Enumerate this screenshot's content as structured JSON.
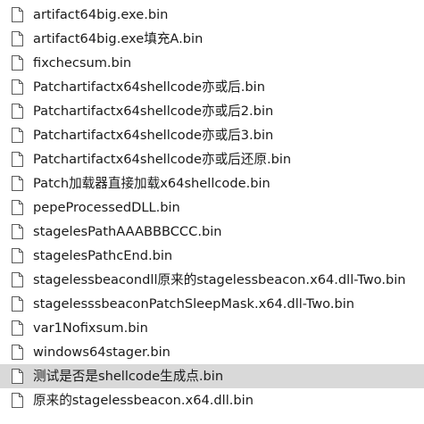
{
  "files": [
    {
      "name": "artifact64big.exe.bin",
      "icon": "file-icon",
      "selected": false
    },
    {
      "name": "artifact64big.exe填充A.bin",
      "icon": "file-icon",
      "selected": false
    },
    {
      "name": "fixchecsum.bin",
      "icon": "file-icon",
      "selected": false
    },
    {
      "name": "Patchartifactx64shellcode亦或后.bin",
      "icon": "file-icon",
      "selected": false
    },
    {
      "name": "Patchartifactx64shellcode亦或后2.bin",
      "icon": "file-icon",
      "selected": false
    },
    {
      "name": "Patchartifactx64shellcode亦或后3.bin",
      "icon": "file-icon",
      "selected": false
    },
    {
      "name": "Patchartifactx64shellcode亦或后还原.bin",
      "icon": "file-icon",
      "selected": false
    },
    {
      "name": "Patch加载器直接加载x64shellcode.bin",
      "icon": "file-icon",
      "selected": false
    },
    {
      "name": "pepeProcessedDLL.bin",
      "icon": "file-icon",
      "selected": false
    },
    {
      "name": "stagelesPathAAABBBCCC.bin",
      "icon": "file-icon",
      "selected": false
    },
    {
      "name": "stagelesPathcEnd.bin",
      "icon": "file-icon",
      "selected": false
    },
    {
      "name": "stagelessbeacondll原来的stagelessbeacon.x64.dll-Two.bin",
      "icon": "file-icon",
      "selected": false
    },
    {
      "name": "stagelesssbeaconPatchSleepMask.x64.dll-Two.bin",
      "icon": "file-icon",
      "selected": false
    },
    {
      "name": "var1Nofixsum.bin",
      "icon": "file-icon",
      "selected": false
    },
    {
      "name": "windows64stager.bin",
      "icon": "file-icon",
      "selected": false
    },
    {
      "name": "测试是否是shellcode生成点.bin",
      "icon": "file-icon",
      "selected": true
    },
    {
      "name": "原来的stagelessbeacon.x64.dll.bin",
      "icon": "file-icon",
      "selected": false
    }
  ],
  "colors": {
    "selected_background": "#d9d9d9",
    "text": "#1a1a1a",
    "icon_stroke": "#5a5a5a"
  }
}
